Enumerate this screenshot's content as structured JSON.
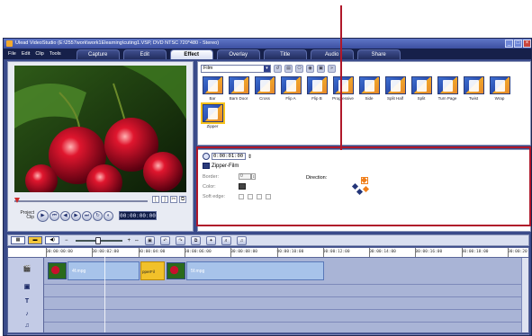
{
  "window": {
    "title": "Ulead VideoStudio (E:\\2557work\\work1Elearning\\cuting1.VSP, DVD NTSC 720*480 - Stereo)",
    "controls": [
      "_",
      "□",
      "×"
    ]
  },
  "menu": [
    "File",
    "Edit",
    "Clip",
    "Tools"
  ],
  "steps": [
    {
      "label": "Capture",
      "active": false
    },
    {
      "label": "Edit",
      "active": false
    },
    {
      "label": "Effect",
      "active": true
    },
    {
      "label": "Overlay",
      "active": false
    },
    {
      "label": "Title",
      "active": false
    },
    {
      "label": "Audio",
      "active": false
    },
    {
      "label": "Share",
      "active": false
    }
  ],
  "player": {
    "mode_label_top": "Project",
    "mode_label_bottom": "Clip",
    "timecode": "00:00:00:00",
    "buttons": [
      "▶",
      "⏮",
      "◀",
      "▶",
      "⏭",
      "↻",
      "◐"
    ]
  },
  "effects": {
    "category": "Film",
    "thumbnails": [
      "Bar",
      "Barn Door",
      "Cross",
      "Flip A",
      "Flip B",
      "Progressive",
      "Side",
      "Split Half",
      "Split",
      "Turn Page",
      "Twist",
      "Wrap",
      "Zipper"
    ]
  },
  "options": {
    "duration": "0:00:01:00",
    "effect_name": "Zipper-Film",
    "border_label": "Border:",
    "border_value": "0",
    "color_label": "Color:",
    "soft_edge_label": "Soft edge:",
    "direction_label": "Direction:"
  },
  "timeline": {
    "ruler": [
      "00:00:00:00",
      "00:00:02:00",
      "00:00:04:00",
      "00:00:06:00",
      "00:00:08:00",
      "00:00:10:00",
      "00:00:12:00",
      "00:00:14:00",
      "00:00:16:00",
      "00:00:18:00",
      "00:00:20"
    ],
    "clip1_label": "4f.mpg",
    "clip2_label": "5f.mpg",
    "transition_label": "pperFil",
    "track_icons": [
      "🎬",
      "▣",
      "T",
      "♪",
      "♫"
    ]
  },
  "colors": {
    "accent_highlight": "#b0182a",
    "selected_tab": "#f3c63a"
  }
}
